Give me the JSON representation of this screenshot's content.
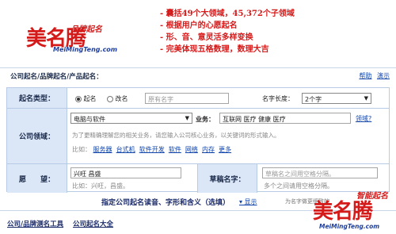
{
  "header": {
    "logo_text": "美名腾",
    "logo_tagline": "品牌起名",
    "logo_url": "MeiMingTeng.com",
    "bullets": [
      "- 囊括49个大领域，45,372个子领域",
      "- 根据用户的心愿起名",
      "- 形、音、意灵活多样变换",
      "- 完美体现五格数理，数理大吉"
    ]
  },
  "bar": {
    "title": "公司起名/品牌起名/产品起名：",
    "help": "帮助",
    "demo": "演示"
  },
  "form": {
    "type": {
      "label": "起名类型：",
      "option_name": "起名",
      "option_rename": "改名",
      "original_placeholder": "原有名字",
      "length_label": "名字长度：",
      "length_value": "2个字"
    },
    "field": {
      "label": "公司领域：",
      "category_value": "电脑与软件",
      "business_label": "业务：",
      "business_value": "互联网 医疗 健康 医疗",
      "help_link": "领域?",
      "hint": "为了更精确理解您的相关业务，请您输入公司核心业务，以关键词的形式输入。",
      "example_label": "比如：",
      "examples": [
        "服务器",
        "台式机",
        "软件开发",
        "软件",
        "网络",
        "内存",
        "更多"
      ]
    },
    "wish": {
      "label": "愿　　望：",
      "value": "兴旺 昌盛",
      "example": "比如：兴旺，昌盛。",
      "draft_label": "草稿名字：",
      "draft_placeholder": "草稿名之间用空格分隔。",
      "draft_hint": "多个之间请用空格分隔。"
    }
  },
  "advanced": {
    "title": "指定公司起名读音、字形和含义（选填）",
    "show": "▾ 显示",
    "note": "为名字做更细致的"
  },
  "footer": {
    "link1": "公司/品牌测名工具",
    "link2": "公司起名大全"
  },
  "brand2": {
    "text": "美名腾",
    "tagline": "智能起名",
    "url": "MeiMingTeng.com"
  }
}
